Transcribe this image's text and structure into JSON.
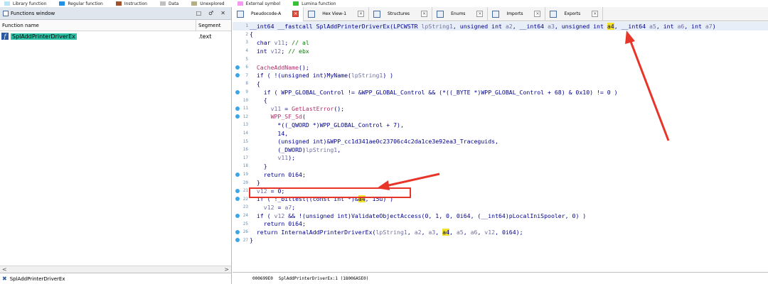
{
  "legend": [
    {
      "label": "Library function",
      "color": "#b8e4f8"
    },
    {
      "label": "Regular function",
      "color": "#1e90e6"
    },
    {
      "label": "Instruction",
      "color": "#a0522d"
    },
    {
      "label": "Data",
      "color": "#c0c0c0"
    },
    {
      "label": "Unexplored",
      "color": "#b5b084"
    },
    {
      "label": "External symbol",
      "color": "#f49af0"
    },
    {
      "label": "Lumina function",
      "color": "#36c236"
    }
  ],
  "functions_window": {
    "title": "Functions window",
    "buttons": [
      "□",
      "♂",
      "✕"
    ],
    "columns": {
      "name": "Function name",
      "segment": "Segment"
    },
    "rows": [
      {
        "name": "SplAddPrinterDriverEx",
        "segment": ".text"
      }
    ],
    "status": "SplAddPrinterDriverEx",
    "scroll_left": "<",
    "scroll_right": ">"
  },
  "tabs": [
    {
      "label": "Pseudocode-A",
      "active": true
    },
    {
      "label": "Hex View-1"
    },
    {
      "label": "Structures"
    },
    {
      "label": "Enums"
    },
    {
      "label": "Imports"
    },
    {
      "label": "Exports"
    }
  ],
  "code": {
    "header": "__int64 __fastcall SplAddPrinterDriverEx(LPCWSTR lpString1, unsigned int a2, __int64 a3, unsigned int a4, __int64 a5, int a6, int a7)",
    "header_line": "1",
    "lines": [
      {
        "n": "2",
        "t": "{"
      },
      {
        "n": "3",
        "t": "  char v11; // al"
      },
      {
        "n": "4",
        "t": "  int v12; // ebx"
      },
      {
        "n": "5",
        "t": ""
      },
      {
        "n": "6",
        "t": "  CacheAddName();"
      },
      {
        "n": "7",
        "t": "  if ( !(unsigned int)MyName(lpString1) )"
      },
      {
        "n": "8",
        "t": "  {"
      },
      {
        "n": "9",
        "t": "    if ( WPP_GLOBAL_Control != &WPP_GLOBAL_Control && (*((_BYTE *)WPP_GLOBAL_Control + 68) & 0x10) != 0 )"
      },
      {
        "n": "10",
        "t": "    {"
      },
      {
        "n": "11",
        "t": "      v11 = GetLastError();"
      },
      {
        "n": "12",
        "t": "      WPP_SF_Sd("
      },
      {
        "n": "13",
        "t": "        *((_QWORD *)WPP_GLOBAL_Control + 7),"
      },
      {
        "n": "14",
        "t": "        14,"
      },
      {
        "n": "15",
        "t": "        (unsigned int)&WPP_cc1d341ae0c23706c4c2da1ce3e92ea3_Traceguids,"
      },
      {
        "n": "16",
        "t": "        (_DWORD)lpString1,"
      },
      {
        "n": "17",
        "t": "        v11);"
      },
      {
        "n": "18",
        "t": "    }"
      },
      {
        "n": "19",
        "t": "    return 0i64;"
      },
      {
        "n": "20",
        "t": "  }"
      },
      {
        "n": "21",
        "t": "  v12 = 0;"
      },
      {
        "n": "22",
        "t": "  if ( !_bittest((const int *)&a4, 15u) )"
      },
      {
        "n": "23",
        "t": "    v12 = a7;"
      },
      {
        "n": "24",
        "t": "  if ( v12 && !(unsigned int)ValidateObjectAccess(0, 1, 0, 0i64, (__int64)pLocalIniSpooler, 0) )"
      },
      {
        "n": "25",
        "t": "    return 0i64;"
      },
      {
        "n": "26",
        "t": "  return InternalAddPrinterDriverEx(lpString1, a2, a3, a4, a5, a6, v12, 0i64);"
      },
      {
        "n": "27",
        "t": "}"
      }
    ]
  },
  "status_bar": {
    "address": "000699E0",
    "location": "SplAddPrinterDriverEx:1 (18006A5E0)"
  }
}
